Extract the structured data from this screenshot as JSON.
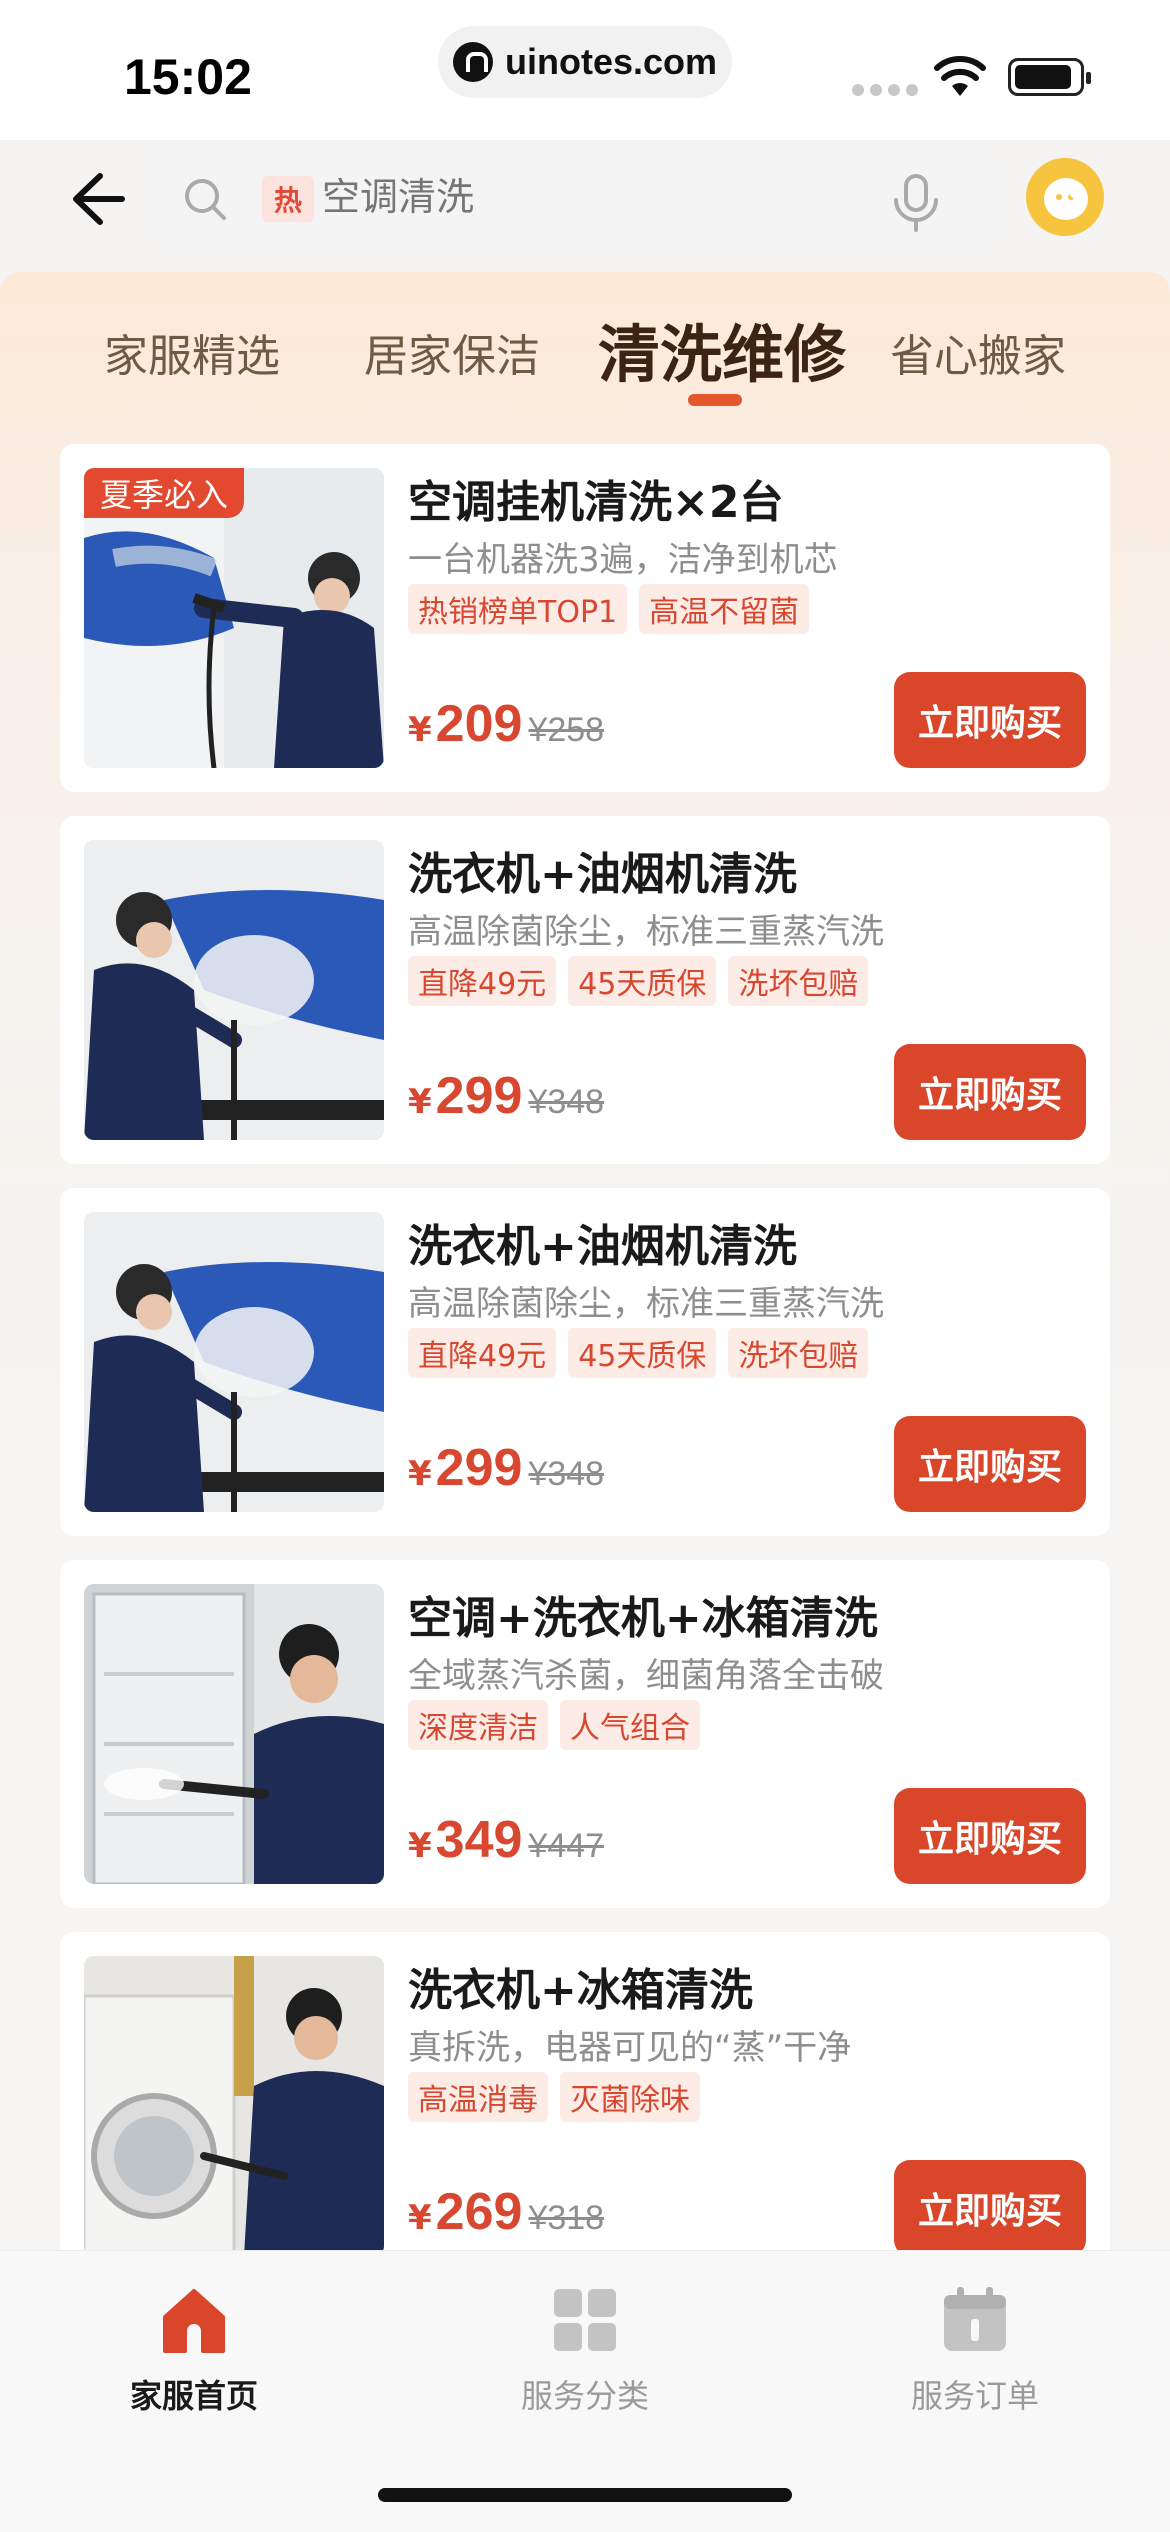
{
  "status_bar": {
    "time": "15:02",
    "url": "uinotes.com"
  },
  "search": {
    "hot_label": "热",
    "placeholder": "空调清洗"
  },
  "category_tabs": [
    {
      "label": "家服精选",
      "active": false
    },
    {
      "label": "居家保洁",
      "active": false
    },
    {
      "label": "清洗维修",
      "active": true
    },
    {
      "label": "省心搬家",
      "active": false
    }
  ],
  "products": [
    {
      "badge": "夏季必入",
      "title": "空调挂机清洗×2台",
      "subtitle": "一台机器洗3遍，洁净到机芯",
      "tags": [
        "热销榜单TOP1",
        "高温不留菌"
      ],
      "currency": "¥",
      "price": "209",
      "original_price": "¥258",
      "buy_label": "立即购买"
    },
    {
      "badge": "",
      "title": "洗衣机+油烟机清洗",
      "subtitle": "高温除菌除尘，标准三重蒸汽洗",
      "tags": [
        "直降49元",
        "45天质保",
        "洗坏包赔"
      ],
      "currency": "¥",
      "price": "299",
      "original_price": "¥348",
      "buy_label": "立即购买"
    },
    {
      "badge": "",
      "title": "洗衣机+油烟机清洗",
      "subtitle": "高温除菌除尘，标准三重蒸汽洗",
      "tags": [
        "直降49元",
        "45天质保",
        "洗坏包赔"
      ],
      "currency": "¥",
      "price": "299",
      "original_price": "¥348",
      "buy_label": "立即购买"
    },
    {
      "badge": "",
      "title": "空调+洗衣机+冰箱清洗",
      "subtitle": "全域蒸汽杀菌，细菌角落全击破",
      "tags": [
        "深度清洁",
        "人气组合"
      ],
      "currency": "¥",
      "price": "349",
      "original_price": "¥447",
      "buy_label": "立即购买"
    },
    {
      "badge": "",
      "title": "洗衣机+冰箱清洗",
      "subtitle": "真拆洗，电器可见的“蒸”干净",
      "tags": [
        "高温消毒",
        "灭菌除味"
      ],
      "currency": "¥",
      "price": "269",
      "original_price": "¥318",
      "buy_label": "立即购买"
    }
  ],
  "bottom_nav": [
    {
      "label": "家服首页",
      "icon": "home-icon",
      "active": true
    },
    {
      "label": "服务分类",
      "icon": "grid-icon",
      "active": false
    },
    {
      "label": "服务订单",
      "icon": "calendar-icon",
      "active": false
    }
  ],
  "colors": {
    "accent": "#d9462a",
    "tab_active": "#3b2414",
    "tag_bg": "#fdebe6"
  }
}
